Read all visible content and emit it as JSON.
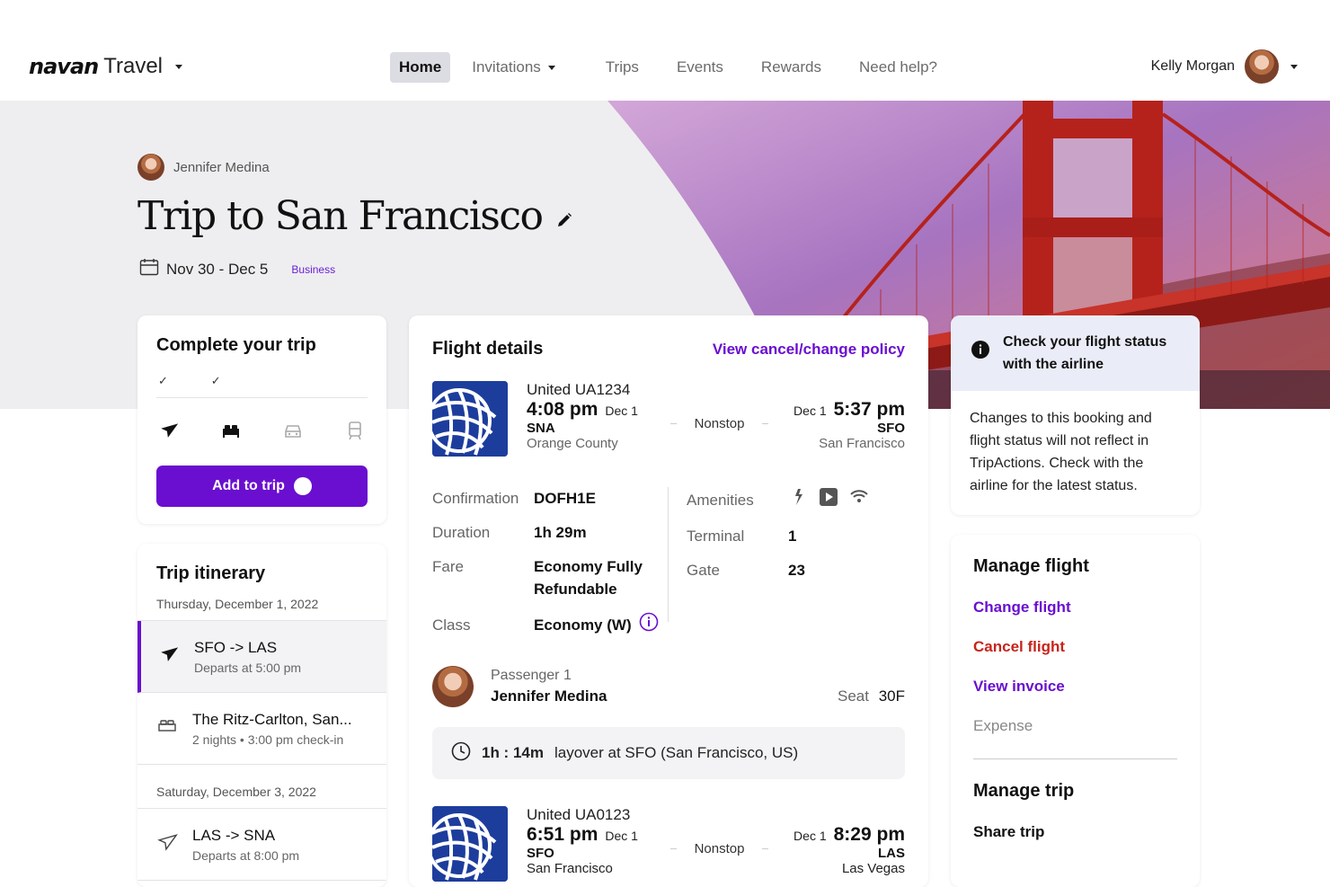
{
  "app": {
    "brand": "navan",
    "product": "Travel"
  },
  "nav": {
    "items": [
      {
        "label": "Home",
        "active": true
      },
      {
        "label": "Invitations",
        "has_dropdown": true
      },
      {
        "label": "Trips"
      },
      {
        "label": "Events"
      },
      {
        "label": "Rewards"
      },
      {
        "label": "Need help?"
      }
    ]
  },
  "user": {
    "name": "Kelly Morgan"
  },
  "trip": {
    "owner": "Jennifer Medina",
    "title": "Trip to San Francisco",
    "dates": "Nov 30 - Dec 5",
    "badge": "Business"
  },
  "complete_trip": {
    "title": "Complete your trip",
    "checks": [
      "✓",
      "✓",
      "",
      ""
    ],
    "modes": [
      "flight-icon",
      "hotel-icon",
      "car-icon",
      "train-icon"
    ],
    "add_button": "Add to trip"
  },
  "itinerary": {
    "title": "Trip itinerary",
    "day1": "Thursday, December 1, 2022",
    "seg1": {
      "title": "SFO -> LAS",
      "sub": "Departs at 5:00 pm"
    },
    "seg2": {
      "title": "The Ritz-Carlton, San...",
      "sub": "2 nights • 3:00 pm check-in"
    },
    "day2": "Saturday, December 3, 2022",
    "seg3": {
      "title": "LAS -> SNA",
      "sub": "Departs at 8:00 pm"
    }
  },
  "flight_details": {
    "title": "Flight details",
    "policy_link": "View cancel/change policy",
    "leg1": {
      "carrier": "United  UA1234",
      "dep_time": "4:08 pm",
      "dep_date": "Dec 1",
      "dep_airport": "SNA",
      "dep_city": "Orange County",
      "stops": "Nonstop",
      "arr_date": "Dec 1",
      "arr_time": "5:37 pm",
      "arr_airport": "SFO",
      "arr_city": "San Francisco"
    },
    "info_left": [
      {
        "key": "Confirmation",
        "value": "DOFH1E"
      },
      {
        "key": "Duration",
        "value": "1h 29m"
      },
      {
        "key": "Fare",
        "value": "Economy Fully Refundable"
      },
      {
        "key": "Class",
        "value": "Economy (W)"
      }
    ],
    "info_right": [
      {
        "key": "Amenities",
        "value": ""
      },
      {
        "key": "Terminal",
        "value": "1"
      },
      {
        "key": "Gate",
        "value": "23"
      }
    ],
    "amenities": [
      "power-icon",
      "video-icon",
      "wifi-icon"
    ],
    "passenger": {
      "label": "Passenger 1",
      "name": "Jennifer Medina",
      "seat_label": "Seat",
      "seat": "30F"
    },
    "layover": {
      "duration": "1h : 14m",
      "text": "layover at SFO (San Francisco, US)"
    },
    "leg2": {
      "carrier": "United  UA0123",
      "dep_time": "6:51 pm",
      "dep_date": "Dec 1",
      "dep_airport": "SFO",
      "dep_city": "San Francisco",
      "stops": "Nonstop",
      "arr_date": "Dec 1",
      "arr_time": "8:29 pm",
      "arr_airport": "LAS",
      "arr_city": "Las Vegas"
    }
  },
  "status_card": {
    "title": "Check your flight status with the airline",
    "body": "Changes to this booking and flight status will not reflect in TripActions. Check with the airline for the latest status."
  },
  "manage": {
    "flight_title": "Manage flight",
    "change": "Change flight",
    "cancel": "Cancel flight",
    "invoice": "View invoice",
    "expense": "Expense",
    "trip_title": "Manage trip",
    "share": "Share trip"
  },
  "colors": {
    "accent": "#6a0fd0",
    "danger": "#c8241b",
    "united_blue": "#1d3d9d"
  }
}
